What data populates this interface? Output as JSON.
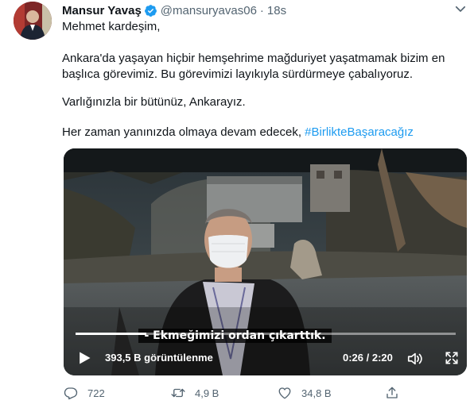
{
  "tweet": {
    "author": {
      "name": "Mansur Yavaş",
      "handle": "@mansuryavas06",
      "separator": "·",
      "time": "18s",
      "verified": true,
      "avatar_icon": "profile-photo"
    },
    "lines": [
      {
        "text": "Mehmet kardeşim,"
      },
      {
        "text": "Ankara'da yaşayan hiçbir hemşehrime mağduriyet yaşatmamak bizim en"
      },
      {
        "text": "başlıca görevimiz. Bu görevimizi layıkıyla sürdürmeye çabalıyoruz."
      },
      {
        "text": "Varlığınızla bir bütünüz, Ankarayız."
      },
      {
        "text": "Her zaman yanınızda olmaya devam edecek, ",
        "hashtag": "#BirlikteBaşaracağız"
      }
    ]
  },
  "video": {
    "subtitle": "- Ekmeğimizi ordan çıkarttık.",
    "views": "393,5 B görüntülenme",
    "timecode": "0:26 / 2:20",
    "progress": 0.186,
    "icons": [
      "play-icon",
      "volume-icon",
      "fullscreen-icon"
    ]
  },
  "actions": {
    "reply_count": "722",
    "retweet_count": "4,9 B",
    "like_count": "34,8 B",
    "icons": [
      "reply-icon",
      "retweet-icon",
      "like-icon",
      "share-icon"
    ]
  },
  "colors": {
    "link": "#1d9bf0",
    "muted": "#536471",
    "text": "#0f1419"
  }
}
